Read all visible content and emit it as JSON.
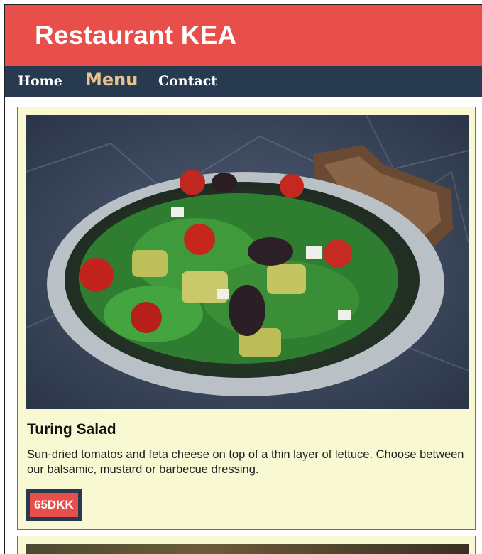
{
  "header": {
    "title": "Restaurant KEA"
  },
  "nav": {
    "items": [
      {
        "label": "Home"
      },
      {
        "label": "Menu"
      },
      {
        "label": "Contact"
      }
    ]
  },
  "menu": {
    "items": [
      {
        "name": "Turing Salad",
        "description": "Sun-dried tomatos and feta cheese on top of a thin layer of lettuce. Choose between our balsamic, mustard or barbecue dressing.",
        "price": "65DKK"
      }
    ]
  },
  "colors": {
    "header_bg": "#e84f4a",
    "nav_bg": "#283a50",
    "nav_active": "#e8c38e",
    "card_bg": "#f8f8d2"
  }
}
